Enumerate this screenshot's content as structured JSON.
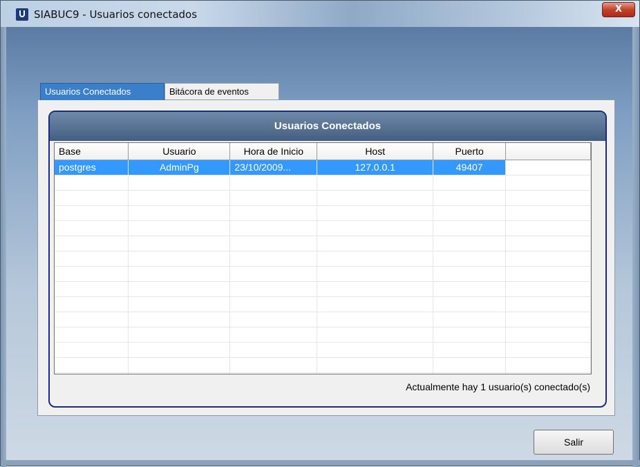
{
  "window": {
    "title": "SIABUC9 -  Usuarios conectados",
    "close_label": "X"
  },
  "tabs": [
    {
      "label": "Usuarios Conectados",
      "active": true
    },
    {
      "label": "Bitácora de eventos",
      "active": false
    }
  ],
  "group": {
    "title": "Usuarios Conectados"
  },
  "grid": {
    "columns": [
      "Base",
      "Usuario",
      "Hora de Inicio",
      "Host",
      "Puerto",
      ""
    ],
    "rows": [
      [
        "postgres",
        "AdminPg",
        "23/10/2009...",
        "127.0.0.1",
        "49407",
        ""
      ]
    ],
    "empty_rows": 14
  },
  "status_text": "Actualmente hay 1 usuario(s) conectado(s)",
  "buttons": {
    "exit_label": "Salir"
  },
  "colors": {
    "selection": "#3399ff",
    "group_border": "#1a2a80",
    "header_dark": "#445e82"
  }
}
